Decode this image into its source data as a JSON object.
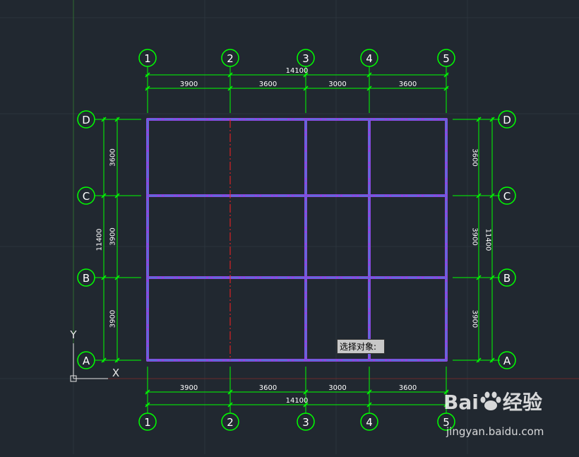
{
  "colors": {
    "background": "#212830",
    "grid": "#2c343d",
    "dimension": "#00ff00",
    "beam": "#8b48e0",
    "beam_core": "#4a7bd6",
    "centerline": "#ff2020",
    "ucs": "#e6e6e6"
  },
  "columns": {
    "labels": [
      "1",
      "2",
      "3",
      "4",
      "5"
    ],
    "spacings": [
      "3900",
      "3600",
      "3000",
      "3600"
    ],
    "total": "14100"
  },
  "rows": {
    "labels": [
      "D",
      "C",
      "B",
      "A"
    ],
    "spacings": [
      "3600",
      "3900",
      "3900"
    ],
    "total": "11400"
  },
  "ucs": {
    "y_label": "Y",
    "x_label": "X"
  },
  "command_prompt": "选择对象:",
  "watermark": {
    "brand_left": "Bai",
    "brand_right": "经验",
    "url": "jingyan.baidu.com",
    "icon": "baidu-paw-icon"
  }
}
